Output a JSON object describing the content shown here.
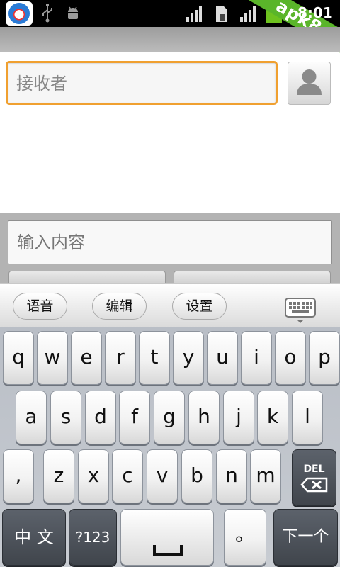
{
  "status_bar": {
    "time": "8:01",
    "watermark": "apk8.com",
    "icons": [
      "app-icon",
      "usb-icon",
      "android-debug-icon",
      "signal-icon",
      "sim-icon",
      "signal-icon",
      "battery-icon"
    ]
  },
  "recipient": {
    "placeholder": "接收者"
  },
  "compose": {
    "placeholder": "输入内容"
  },
  "ime_toolbar": {
    "voice": "语音",
    "edit": "编辑",
    "settings": "设置"
  },
  "keyboard": {
    "row1": [
      "q",
      "w",
      "e",
      "r",
      "t",
      "y",
      "u",
      "i",
      "o",
      "p"
    ],
    "row2": [
      "a",
      "s",
      "d",
      "f",
      "g",
      "h",
      "j",
      "k",
      "l"
    ],
    "row3": [
      ",",
      "z",
      "x",
      "c",
      "v",
      "b",
      "n",
      "m"
    ],
    "del": "DEL",
    "lang": "中 文",
    "sym": "?123",
    "period": "。",
    "next": "下一个"
  },
  "colors": {
    "focus_border": "#f0a030",
    "status_green": "#5ab52a"
  }
}
